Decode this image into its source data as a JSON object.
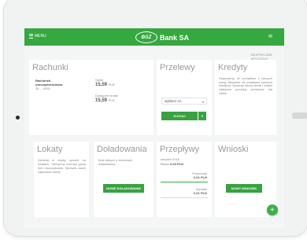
{
  "header": {
    "menu_label": "MENU",
    "logo_mark": "BGŻ",
    "brand": "Bank SA",
    "mail_icon": "envelope-icon"
  },
  "logout": "BEZPIECZNE WYLOGUJ",
  "rachunki": {
    "title": "Rachunki",
    "account_name": "Rachunek oszczędnościowo-",
    "account_number": "34 ... 0002",
    "saldo_label": "Saldo",
    "saldo_value": "15,59",
    "saldo_currency": "PLN",
    "dostepne_label": "Dostępne środki",
    "dostepne_value": "15,59",
    "dostepne_currency": "PLN"
  },
  "przelewy": {
    "title": "Przelewy",
    "select_value": "wybierz sz...",
    "button_label": "ZLECAJ"
  },
  "kredyty": {
    "title": "Kredyty",
    "text": "Dziękujemy, że korzystasz z naszych usług. Aktualnie nie posiadasz żadnych kredytów. Sprawdź naszą ofertę i znajdź najlepsze produkty kredytowe dla siebie."
  },
  "lokaty": {
    "title": "Lokaty",
    "text": "Zarabiaj w mądry sposób na lokatach. Oferujemy szeroką gamę form oszczędzania. Sprawdź nasze najnowsze oferty."
  },
  "doladowania": {
    "title": "Doładowania",
    "text": "Brak danych o zleceniach doładowania.",
    "button_label": "NOWE DOŁADOWANIE"
  },
  "przeplywy": {
    "title": "Przepływy",
    "period": "sierpień 2015",
    "saldo_label": "Bilans",
    "saldo_value": "0,00 PLN",
    "wplywy_label": "Przychody",
    "wplywy_value": "0,01 PLN",
    "wydatki_label": "Wydatki",
    "wydatki_value": "0,01 PLN",
    "wplywy_fraction": 1.0
  },
  "wnioski": {
    "title": "Wnioski",
    "button_label": "NOWY WNIOSEK"
  },
  "fab_label": "+"
}
